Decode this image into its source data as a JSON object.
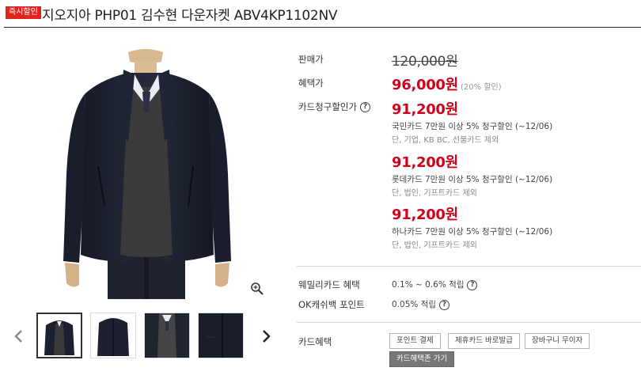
{
  "header": {
    "badge": "즉시할인",
    "title": "지오지아 PHP01 김수현 다운자켓 ABV4KP1102NV"
  },
  "gallery": {
    "thumbnail_count": 4,
    "active_index": 0
  },
  "pricing": {
    "sale_label": "판매가",
    "sale_price": "120,000원",
    "benefit_label": "혜택가",
    "benefit_price": "96,000원",
    "benefit_note": "(20% 할인)",
    "card_label": "카드청구할인가",
    "cards": [
      {
        "price": "91,200원",
        "desc": "국민카드 7만원 이상 5% 청구할인 (~12/06)",
        "note": "단, 기업, KB BC, 선불카드 제외"
      },
      {
        "price": "91,200원",
        "desc": "롯데카드 7만원 이상 5% 청구할인 (~12/06)",
        "note": "단, 법인, 기프트카드 제외"
      },
      {
        "price": "91,200원",
        "desc": "하나카드 7만원 이상 5% 청구할인 (~12/06)",
        "note": "단, 법인, 기프트카드 제외"
      }
    ]
  },
  "points": {
    "family_label": "웨밀리카드 혜택",
    "family_value": "0.1% ~ 0.6% 적립",
    "ok_label": "OK캐쉬백 포인트",
    "ok_value": "0.05% 적립"
  },
  "card_benefit": {
    "label": "카드혜택",
    "buttons": [
      "포인트 결제",
      "제휴카드 바로발급",
      "장바구니 무이자"
    ],
    "zone_button": "카드혜택존 가기"
  },
  "colors": {
    "accent_red": "#d0021b",
    "badge_red": "#e2241f",
    "jacket": "#1d2130",
    "sweater": "#3a3a3a"
  }
}
